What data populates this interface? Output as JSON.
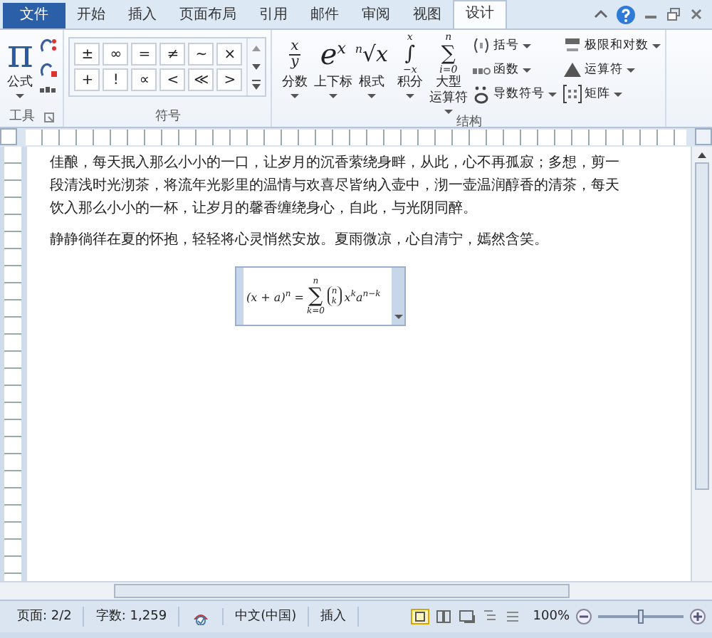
{
  "tabs": [
    {
      "label": "文件",
      "kind": "file",
      "selected": false
    },
    {
      "label": "开始",
      "kind": "tab",
      "selected": false
    },
    {
      "label": "插入",
      "kind": "tab",
      "selected": false
    },
    {
      "label": "页面布局",
      "kind": "tab",
      "selected": false
    },
    {
      "label": "引用",
      "kind": "tab",
      "selected": false
    },
    {
      "label": "邮件",
      "kind": "tab",
      "selected": false
    },
    {
      "label": "审阅",
      "kind": "tab",
      "selected": false
    },
    {
      "label": "视图",
      "kind": "tab",
      "selected": false
    },
    {
      "label": "设计",
      "kind": "tab",
      "selected": true
    }
  ],
  "ribbon": {
    "groups": [
      {
        "kind": "tools",
        "label": "工具",
        "formula": {
          "glyph": "π",
          "label": "公式"
        }
      },
      {
        "kind": "symbols",
        "label": "符号",
        "symbols": [
          "±",
          "∞",
          "=",
          "≠",
          "~",
          "×",
          "+",
          "!",
          "∝",
          "<",
          "≪",
          ">"
        ]
      },
      {
        "kind": "structures",
        "label": "结构",
        "large": [
          {
            "kind": "fraction",
            "upper": "x",
            "lower": "y",
            "label_lines": [
              "分数"
            ]
          },
          {
            "kind": "script",
            "glyph": "e$^{x}$",
            "label_lines": [
              "上下标"
            ]
          },
          {
            "kind": "radical",
            "glyph": "$^{n}$√x",
            "label_lines": [
              "根式"
            ]
          },
          {
            "kind": "integral",
            "glyph": "∫",
            "upper": "x",
            "lower": "−x",
            "label_lines": [
              "积分"
            ]
          },
          {
            "kind": "operator",
            "glyph": "∑",
            "upper": "n",
            "lower": "i=0",
            "label_lines": [
              "大型",
              "运算符"
            ]
          }
        ],
        "small": [
          {
            "kind": "bracket",
            "label": "括号"
          },
          {
            "kind": "function",
            "label": "函数"
          },
          {
            "kind": "accent",
            "label": "导数符号"
          },
          {
            "kind": "limit",
            "label": "极限和对数"
          },
          {
            "kind": "operator",
            "label": "运算符"
          },
          {
            "kind": "matrix",
            "label": "矩阵"
          }
        ]
      }
    ]
  },
  "document": {
    "paragraphs": [
      "佳酿，每天抿入那么小小的一口，让岁月的沉香萦绕身畔，从此，心不再孤寂；多想，剪一段清浅时光沏茶，将流年光影里的温情与欢喜尽皆纳入壶中，沏一壶温润醇香的清茶，每天饮入那么小小的一杯，让岁月的馨香缠绕身心，自此，与光阴同醉。",
      "静静徜徉在夏的怀抱，轻轻将心灵悄然安放。夏雨微凉，心自清宁，嫣然含笑。"
    ]
  },
  "equation": {
    "lhs": "(x + a)$^{n}$ =",
    "operator": "∑",
    "upper": "n",
    "lower": "k=0",
    "binom_top": "n",
    "binom_bottom": "k",
    "rhs": "x$^{k}$a$^{n−k}$"
  },
  "status_bar": {
    "items": [
      {
        "kind": "text",
        "label": "页面: 2/2"
      },
      {
        "kind": "text",
        "label": "字数: 1,259"
      },
      {
        "kind": "proofing"
      },
      {
        "kind": "text",
        "label": "中文(中国)"
      },
      {
        "kind": "text",
        "label": "插入"
      }
    ],
    "zoom": "100%",
    "zoom_slider": {
      "level": 0.5
    }
  }
}
